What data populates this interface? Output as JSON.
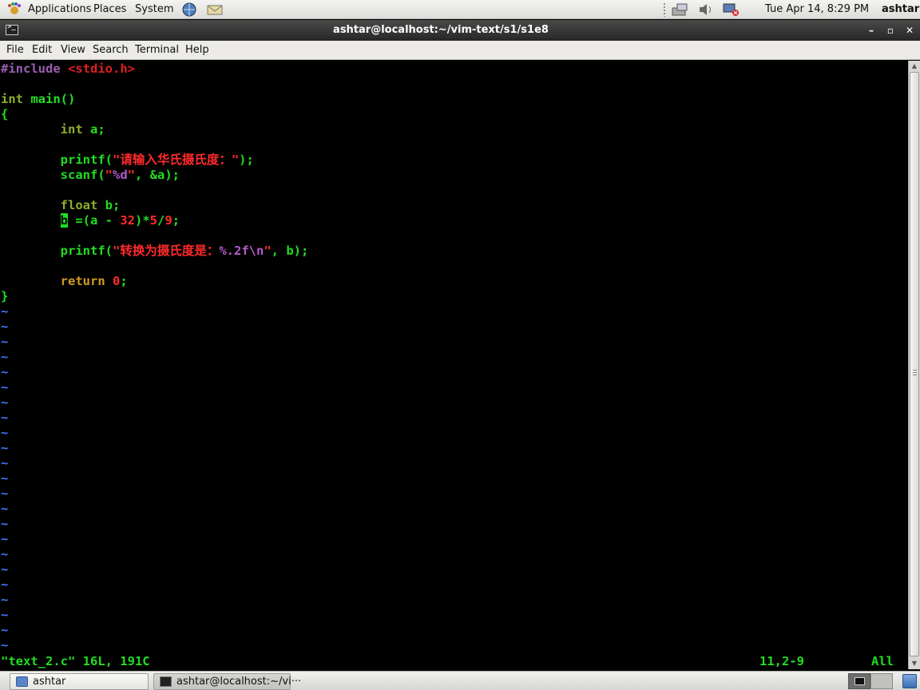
{
  "top_panel": {
    "applications": "Applications",
    "places": "Places",
    "system": "System",
    "clock": "Tue Apr 14,  8:29 PM",
    "user": "ashtar",
    "icons": [
      "foot-logo-icon",
      "web-browser-icon",
      "mail-client-icon",
      "network-applet-icon",
      "volume-icon",
      "network-disconnected-icon"
    ]
  },
  "window": {
    "title": "ashtar@localhost:~/vim-text/s1/s1e8",
    "minimize": "–",
    "maximize": "▫",
    "close": "✕"
  },
  "menubar": {
    "file": "File",
    "edit": "Edit",
    "view": "View",
    "search": "Search",
    "terminal": "Terminal",
    "help": "Help"
  },
  "editor": {
    "include_directive": "#include",
    "include_file": "<stdio.h>",
    "main_type": "int",
    "main_sig": " main()",
    "open_brace": "{",
    "decl_a_type": "int",
    "decl_a_rest": " a;",
    "printf1_fn": "printf(",
    "printf1_str": "\"请输入华氏摄氏度：\"",
    "printf1_end": ");",
    "scanf_fn": "scanf(",
    "scanf_q1": "\"",
    "scanf_fmt": "%d",
    "scanf_q2": "\"",
    "scanf_rest": ", &a);",
    "decl_b_type": "float",
    "decl_b_rest": " b;",
    "assign_cursor": "b",
    "assign_a": " =(a - ",
    "assign_32": "32",
    "assign_mul": ")*",
    "assign_5": "5",
    "assign_div": "/",
    "assign_9": "9",
    "assign_end": ";",
    "printf2_fn": "printf(",
    "printf2_str": "\"转换为摄氏度是：",
    "printf2_fmt": "%.2f\\n",
    "printf2_q": "\"",
    "printf2_end": ", b);",
    "return_kw": "return",
    "return_val": "0",
    "return_end": ";",
    "close_brace": "}",
    "tilde": "~",
    "status_file": "\"text_2.c\" 16L, 191C",
    "status_pos": "11,2-9",
    "status_scroll": "All"
  },
  "taskbar": {
    "task1": "ashtar",
    "task2": "ashtar@localhost:~/vi···"
  },
  "colors": {
    "keyword_green": "#22dd22",
    "string_red": "#ff2a2a",
    "type_olive": "#8fae2a",
    "return_gold": "#d09b1f",
    "preproc_purple": "#9b5fb0",
    "tilde_blue": "#3f78ff"
  }
}
